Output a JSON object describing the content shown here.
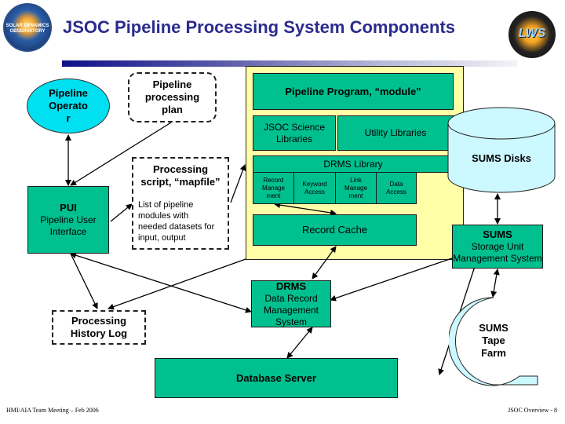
{
  "header": {
    "title": "JSOC Pipeline Processing System Components",
    "left_logo": {
      "icon": "sdo-logo-icon",
      "text": "SOLAR DYNAMICS OBSERVATORY"
    },
    "right_logo": {
      "icon": "lws-logo-icon",
      "text": "LWS"
    },
    "accent_color": "#2b2b8f"
  },
  "nodes": {
    "pipeline_operator": {
      "line1": "Pipeline",
      "line2": "Operato",
      "line3": "r"
    },
    "processing_plan": {
      "line1": "Pipeline",
      "line2": "processing",
      "line3": "plan"
    },
    "pui": {
      "title": "PUI",
      "line1": "Pipeline User",
      "line2": "Interface"
    },
    "mapfile": {
      "title1": "Processing",
      "title2": "script, “mapfile”",
      "desc1": "List of pipeline",
      "desc2": "modules with",
      "desc3": "needed datasets for",
      "desc4": "input, output"
    },
    "module": {
      "title": "Pipeline Program, “module”",
      "science_libs1": "JSOC Science",
      "science_libs2": "Libraries",
      "utility_libs": "Utility Libraries",
      "drms_library": "DRMS Library",
      "record_mgmt": [
        "Record",
        "Manage",
        "ment"
      ],
      "keyword_access": [
        "Keyword",
        "Access"
      ],
      "link_mgmt": [
        "Link",
        "Manage",
        "ment"
      ],
      "data_access": [
        "Data",
        "Access"
      ],
      "record_cache": "Record Cache"
    },
    "sums_disks": "SUMS Disks",
    "sums": {
      "title": "SUMS",
      "line1": "Storage Unit",
      "line2": "Management System"
    },
    "drms": {
      "title": "DRMS",
      "line1": "Data Record",
      "line2": "Management System"
    },
    "history_log": {
      "line1": "Processing",
      "line2": "History Log"
    },
    "sums_tape": {
      "line1": "SUMS",
      "line2": "Tape",
      "line3": "Farm"
    },
    "database_server": "Database Server"
  },
  "colors": {
    "component_green": "#00c08f",
    "container_yellow": "#ffffa8",
    "storage_cyan": "#ccf8ff",
    "operator_cyan": "#00e0f0"
  },
  "footer": {
    "left": "HMI/AIA Team Meeting – Feb 2006",
    "right": "JSOC Overview - 8"
  }
}
